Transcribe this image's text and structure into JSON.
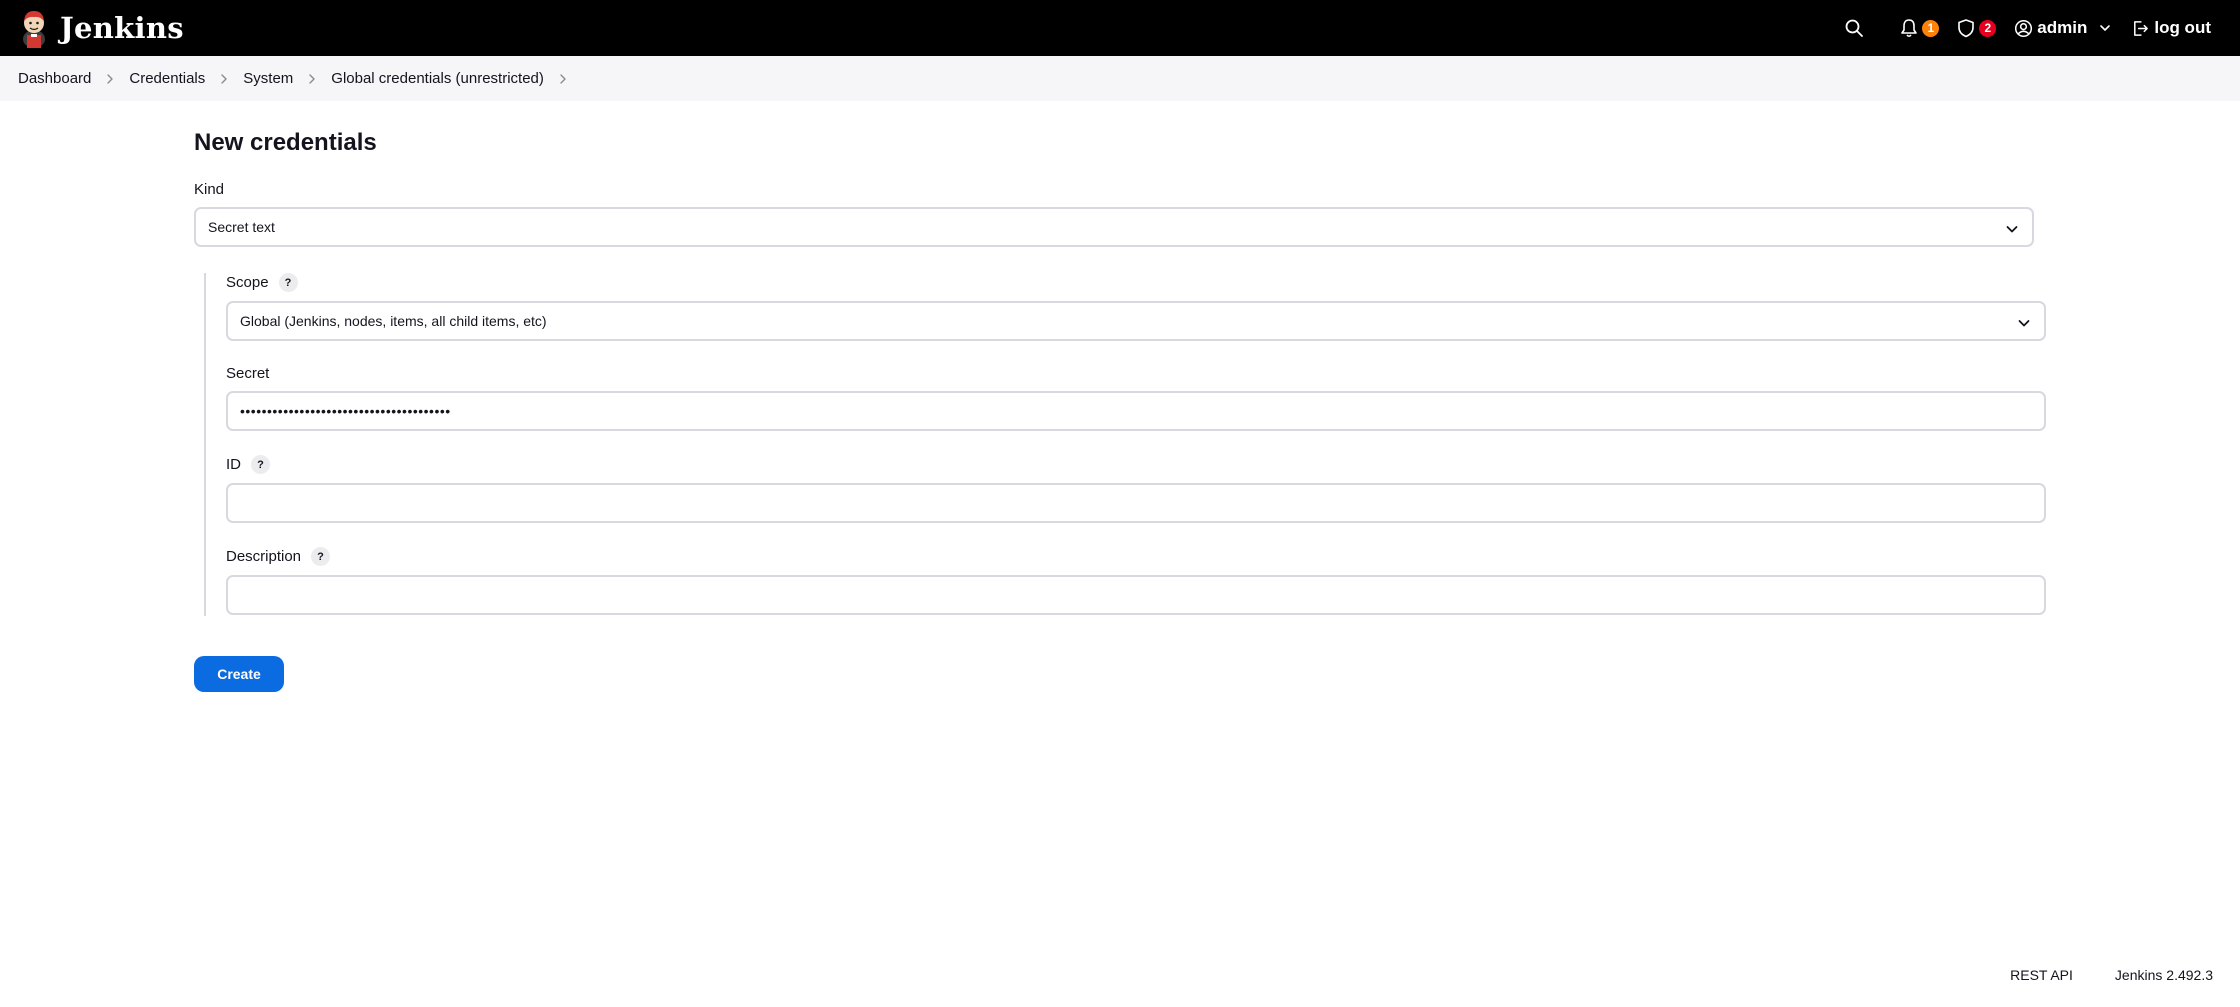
{
  "header": {
    "app_name": "Jenkins",
    "notifications_count": "1",
    "security_count": "2",
    "user_name": "admin",
    "logout_label": "log out",
    "colors": {
      "background": "#000000",
      "notification_badge": "#fe820a",
      "security_badge": "#e6001f"
    }
  },
  "breadcrumb": [
    "Dashboard",
    "Credentials",
    "System",
    "Global credentials (unrestricted)"
  ],
  "page": {
    "title": "New credentials",
    "kind": {
      "label": "Kind",
      "value": "Secret text"
    },
    "scope": {
      "label": "Scope",
      "help": "?",
      "value": "Global (Jenkins, nodes, items, all child items, etc)"
    },
    "secret": {
      "label": "Secret",
      "value": "•••••••••••••••••••••••••••••••••••••••"
    },
    "id": {
      "label": "ID",
      "help": "?",
      "value": ""
    },
    "description": {
      "label": "Description",
      "help": "?",
      "value": ""
    },
    "create_label": "Create",
    "accent_color": "#0b6be0"
  },
  "footer": {
    "rest_api": "REST API",
    "version": "Jenkins 2.492.3"
  }
}
